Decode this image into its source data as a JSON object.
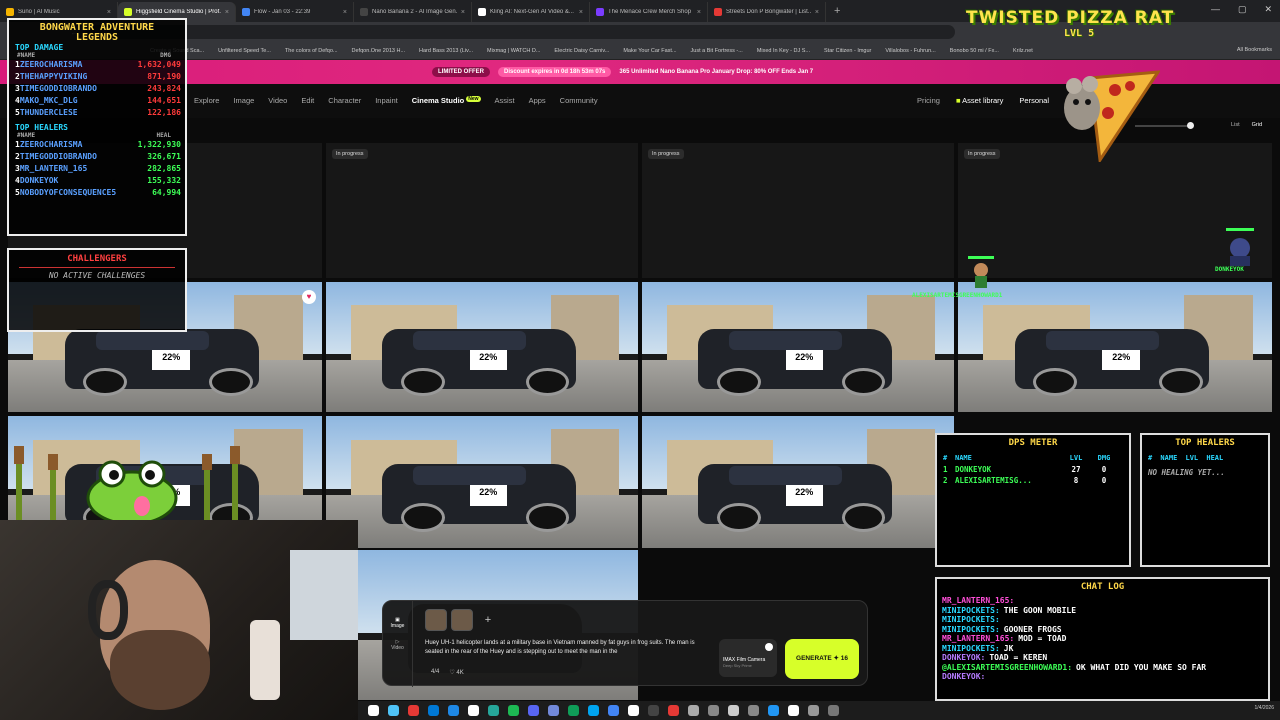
{
  "browser": {
    "tabs": [
      {
        "title": "Suno | AI Music",
        "color": "#f5b400",
        "active": false
      },
      {
        "title": "Higgsfield Cinema Studio | Prof...",
        "color": "#d7ff29",
        "active": true
      },
      {
        "title": "Flow - Jan 03 - 22:39",
        "color": "#4285f4",
        "active": false
      },
      {
        "title": "Nano Banana 2 - AI Image Gen...",
        "color": "#444444",
        "active": false
      },
      {
        "title": "Kling AI: Next-Gen AI Video &...",
        "color": "#ffffff",
        "active": false
      },
      {
        "title": "The Menace Crew Merch Shop",
        "color": "#7b3cff",
        "active": false
      },
      {
        "title": "Streets Don P Bongwater | List...",
        "color": "#e53935",
        "active": false
      }
    ],
    "new_tab": "+",
    "window_controls": [
      "—",
      "▢",
      "✕"
    ],
    "bookmarks": [
      "Create a Sound Sca...",
      "Unfiltered Speed Te...",
      "The colors of Defqo...",
      "Defqon.One 2013 H...",
      "Hard Bass 2013 (Liv...",
      "Mixmag | WATCH D...",
      "Electric Daisy Carniv...",
      "Make Your Car Fast...",
      "Just a Bit Fortress -...",
      "Mixed In Key - DJ S...",
      "Star Citizen - Imgur",
      "Villalobos - Fuhrun...",
      "Bonobo 50 mi / Fx...",
      "Krilz.net"
    ],
    "all_bookmarks": "All Bookmarks"
  },
  "promo": {
    "limited": "LIMITED OFFER",
    "discount": "Discount expires in 0d 18h 53m 07s",
    "message": "365 Unlimited Nano Banana Pro January Drop: 80% OFF Ends Jan 7"
  },
  "nav": {
    "items": [
      "Explore",
      "Image",
      "Video",
      "Edit",
      "Character",
      "Inpaint",
      "Cinema Studio",
      "Assist",
      "Apps",
      "Community"
    ],
    "new_badge": "New",
    "pricing": "Pricing",
    "asset_library": "Asset library",
    "personal": "Personal",
    "view_list": "List",
    "view_grid": "Grid"
  },
  "grid": {
    "status_label": "In progress",
    "decal": "22%"
  },
  "overlay": {
    "title_line1": "BONGWATER ADVENTURE",
    "title_line2": "LEGENDS",
    "top_damage_label": "TOP DAMAGE",
    "damage_header": {
      "name": "#NAME",
      "value": "DMG"
    },
    "damage": [
      {
        "rank": "1",
        "name": "ZEEROCHARISMA",
        "value": "1,632,049"
      },
      {
        "rank": "2",
        "name": "THEHAPPYVIKING",
        "value": "871,190"
      },
      {
        "rank": "3",
        "name": "TIMEGODDIOBRANDO",
        "value": "243,824"
      },
      {
        "rank": "4",
        "name": "MAKO_MKC_DLG",
        "value": "144,651"
      },
      {
        "rank": "5",
        "name": "THUNDERCLESE",
        "value": "122,186"
      }
    ],
    "top_healers_label": "TOP HEALERS",
    "heal_header": {
      "name": "#NAME",
      "value": "HEAL"
    },
    "heal": [
      {
        "rank": "1",
        "name": "ZEEROCHARISMA",
        "value": "1,322,930"
      },
      {
        "rank": "2",
        "name": "TIMEGODDIOBRANDO",
        "value": "326,671"
      },
      {
        "rank": "3",
        "name": "MR_LANTERN_165",
        "value": "282,865"
      },
      {
        "rank": "4",
        "name": "DONKEYOK",
        "value": "155,332"
      },
      {
        "rank": "5",
        "name": "NOBODYOFCONSEQUENCE5",
        "value": "64,994"
      }
    ],
    "challengers_title": "CHALLENGERS",
    "challengers_empty": "NO ACTIVE CHALLENGES",
    "brand": "TWISTED PIZZA RAT",
    "level": "LVL 5",
    "dps_title": "DPS METER",
    "dps_header": [
      "#",
      "NAME",
      "LVL",
      "DMG"
    ],
    "dps_rows": [
      {
        "rank": "1",
        "name": "DONKEYOK",
        "lvl": "27",
        "dmg": "0"
      },
      {
        "rank": "2",
        "name": "ALEXISARTEMISG...",
        "lvl": "8",
        "dmg": "0"
      }
    ],
    "th_title": "TOP HEALERS",
    "th_header": "# NAME LVL HEAL",
    "th_empty": "NO HEALING YET...",
    "chat_title": "CHAT LOG",
    "chat": [
      {
        "user": "MR_LANTERN_165:",
        "msg": "",
        "color": "#ff4fd8"
      },
      {
        "user": "MINIPOCKETS:",
        "msg": "THE GOON MOBILE",
        "color": "#2ad8ff"
      },
      {
        "user": "MINIPOCKETS:",
        "msg": "",
        "color": "#2ad8ff"
      },
      {
        "user": "MINIPOCKETS:",
        "msg": "GOONER FROGS",
        "color": "#2ad8ff"
      },
      {
        "user": "MR_LANTERN_165:",
        "msg": "MOD = TOAD",
        "color": "#ff4fd8"
      },
      {
        "user": "MINIPOCKETS:",
        "msg": "JK",
        "color": "#2ad8ff"
      },
      {
        "user": "DONKEYOK:",
        "msg": "TOAD = KEREN",
        "color": "#b57bff"
      },
      {
        "user": "@ALEXISARTEMISGREENHOWARD1:",
        "msg": "OK WHAT DID YOU MAKE SO FAR",
        "color": "#3dff57"
      },
      {
        "user": "DONKEYOK:",
        "msg": "",
        "color": "#b57bff"
      }
    ],
    "sprite_donkey": "DONKEYOK",
    "sprite_alexis": "ALEXISARTEMISGREENHOWARD1"
  },
  "composer": {
    "mode_image": "Image",
    "mode_video": "Video",
    "add_ref": "+",
    "prompt": "Huey UH-1 helicopter lands at a military base in Vietnam manned by fat guys in frog suits. The man is seated in the rear of the Huey and is stepping out to meet the man in the",
    "count": "4/4",
    "quality": "4K",
    "camera_title": "IMAX Film Camera",
    "camera_sub": "Deep Sky Prime",
    "generate": "GENERATE ✦ 16"
  },
  "taskbar": {
    "icon_colors": [
      "#ffffff",
      "#4fc3f7",
      "#e53935",
      "#0078d4",
      "#1e88e5",
      "#ffffff",
      "#26a69a",
      "#1db954",
      "#5865f2",
      "#7289da",
      "#0f9d58",
      "#00a4ef",
      "#4285f4",
      "#ffffff",
      "#444444",
      "#e53935",
      "#aaaaaa",
      "#888888",
      "#cccccc",
      "#888888",
      "#2196f3",
      "#ffffff",
      "#999999",
      "#777777"
    ],
    "clock": "1/4/2026"
  }
}
